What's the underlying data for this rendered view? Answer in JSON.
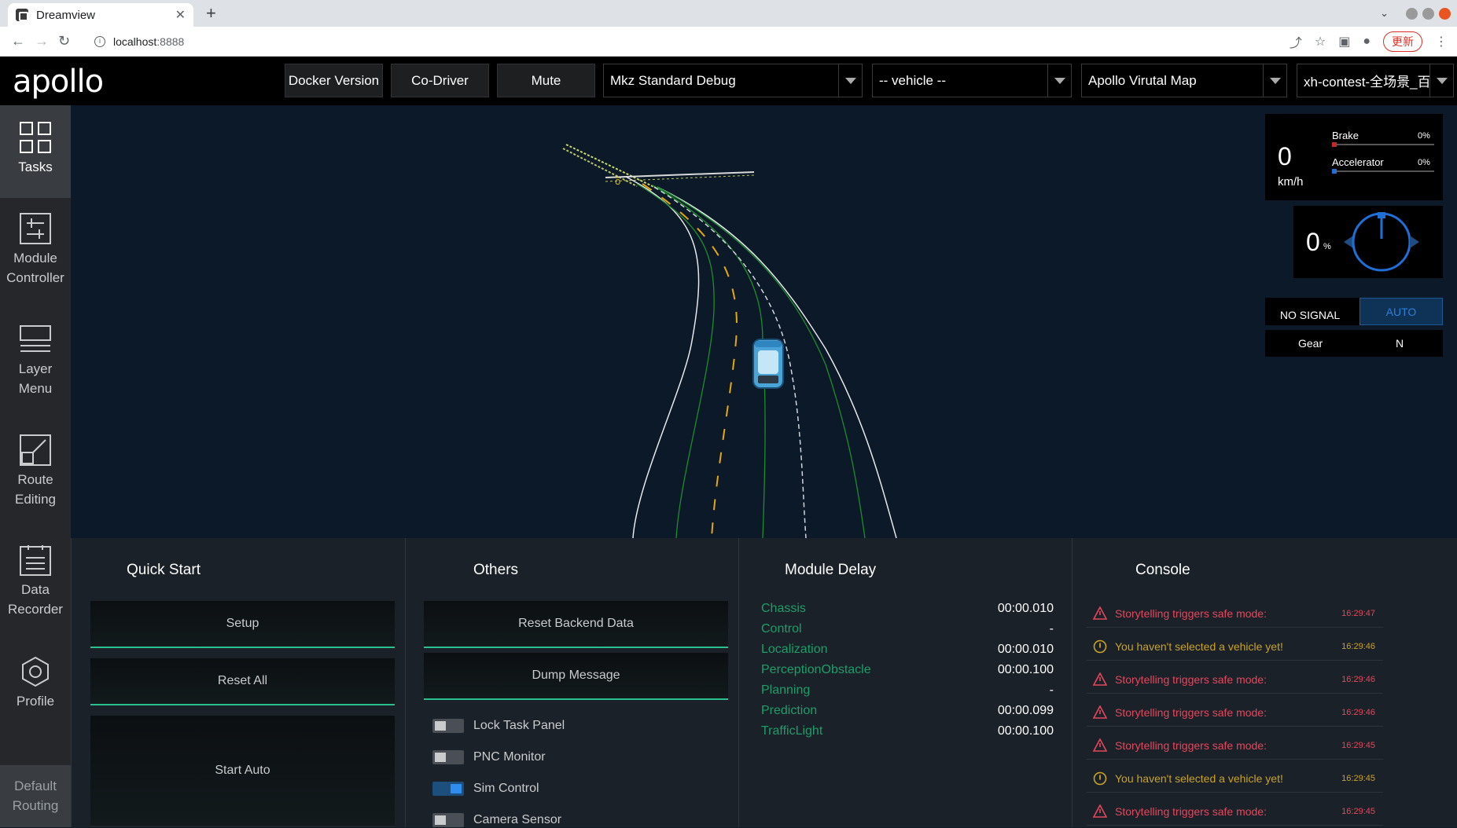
{
  "browser": {
    "tab_title": "Dreamview",
    "tab_close": "✕",
    "new_tab": "+",
    "url_host": "localhost",
    "url_port": ":8888",
    "update_label": "更新"
  },
  "header": {
    "logo": "apollo",
    "docker_version": "Docker Version",
    "co_driver": "Co-Driver",
    "mute": "Mute",
    "mode_select": "Mkz Standard Debug",
    "vehicle_select": "-- vehicle --",
    "map_select": "Apollo Virutal Map",
    "scenario_select": "xh-contest-全场景_百度"
  },
  "sidebar": {
    "items": [
      {
        "line1": "Tasks",
        "line2": ""
      },
      {
        "line1": "Module",
        "line2": "Controller"
      },
      {
        "line1": "Layer",
        "line2": "Menu"
      },
      {
        "line1": "Route",
        "line2": "Editing"
      },
      {
        "line1": "Data",
        "line2": "Recorder"
      },
      {
        "line1": "Profile",
        "line2": ""
      }
    ],
    "default_routing": {
      "line1": "Default",
      "line2": "Routing"
    }
  },
  "dashboard": {
    "speed": "0",
    "speed_unit": "km/h",
    "brake_label": "Brake",
    "brake_pct": "0%",
    "accel_label": "Accelerator",
    "accel_pct": "0%",
    "steering": "0",
    "steering_unit": "%",
    "signal": "NO SIGNAL",
    "drive_mode": "AUTO",
    "gear_label": "Gear",
    "gear_value": "N",
    "colors": {
      "brake": "#c62828",
      "accel": "#1f6fd6",
      "steer": "#1f6fd6"
    }
  },
  "quick_start": {
    "title": "Quick Start",
    "setup": "Setup",
    "reset_all": "Reset All",
    "start_auto": "Start Auto"
  },
  "others": {
    "title": "Others",
    "reset_backend": "Reset Backend Data",
    "dump_message": "Dump Message",
    "toggles": [
      {
        "label": "Lock Task Panel",
        "on": false
      },
      {
        "label": "PNC Monitor",
        "on": false
      },
      {
        "label": "Sim Control",
        "on": true
      },
      {
        "label": "Camera Sensor",
        "on": false
      }
    ]
  },
  "module_delay": {
    "title": "Module Delay",
    "rows": [
      {
        "name": "Chassis",
        "value": "00:00.010"
      },
      {
        "name": "Control",
        "value": "-"
      },
      {
        "name": "Localization",
        "value": "00:00.010"
      },
      {
        "name": "PerceptionObstacle",
        "value": "00:00.100"
      },
      {
        "name": "Planning",
        "value": "-"
      },
      {
        "name": "Prediction",
        "value": "00:00.099"
      },
      {
        "name": "TrafficLight",
        "value": "00:00.100"
      }
    ]
  },
  "console": {
    "title": "Console",
    "rows": [
      {
        "level": "err",
        "msg": "Storytelling triggers safe mode:",
        "time": "16:29:47"
      },
      {
        "level": "warn",
        "msg": "You haven't selected a vehicle yet!",
        "time": "16:29:46"
      },
      {
        "level": "err",
        "msg": "Storytelling triggers safe mode:",
        "time": "16:29:46"
      },
      {
        "level": "err",
        "msg": "Storytelling triggers safe mode:",
        "time": "16:29:46"
      },
      {
        "level": "err",
        "msg": "Storytelling triggers safe mode:",
        "time": "16:29:45"
      },
      {
        "level": "warn",
        "msg": "You haven't selected a vehicle yet!",
        "time": "16:29:45"
      },
      {
        "level": "err",
        "msg": "Storytelling triggers safe mode:",
        "time": "16:29:45"
      }
    ]
  }
}
